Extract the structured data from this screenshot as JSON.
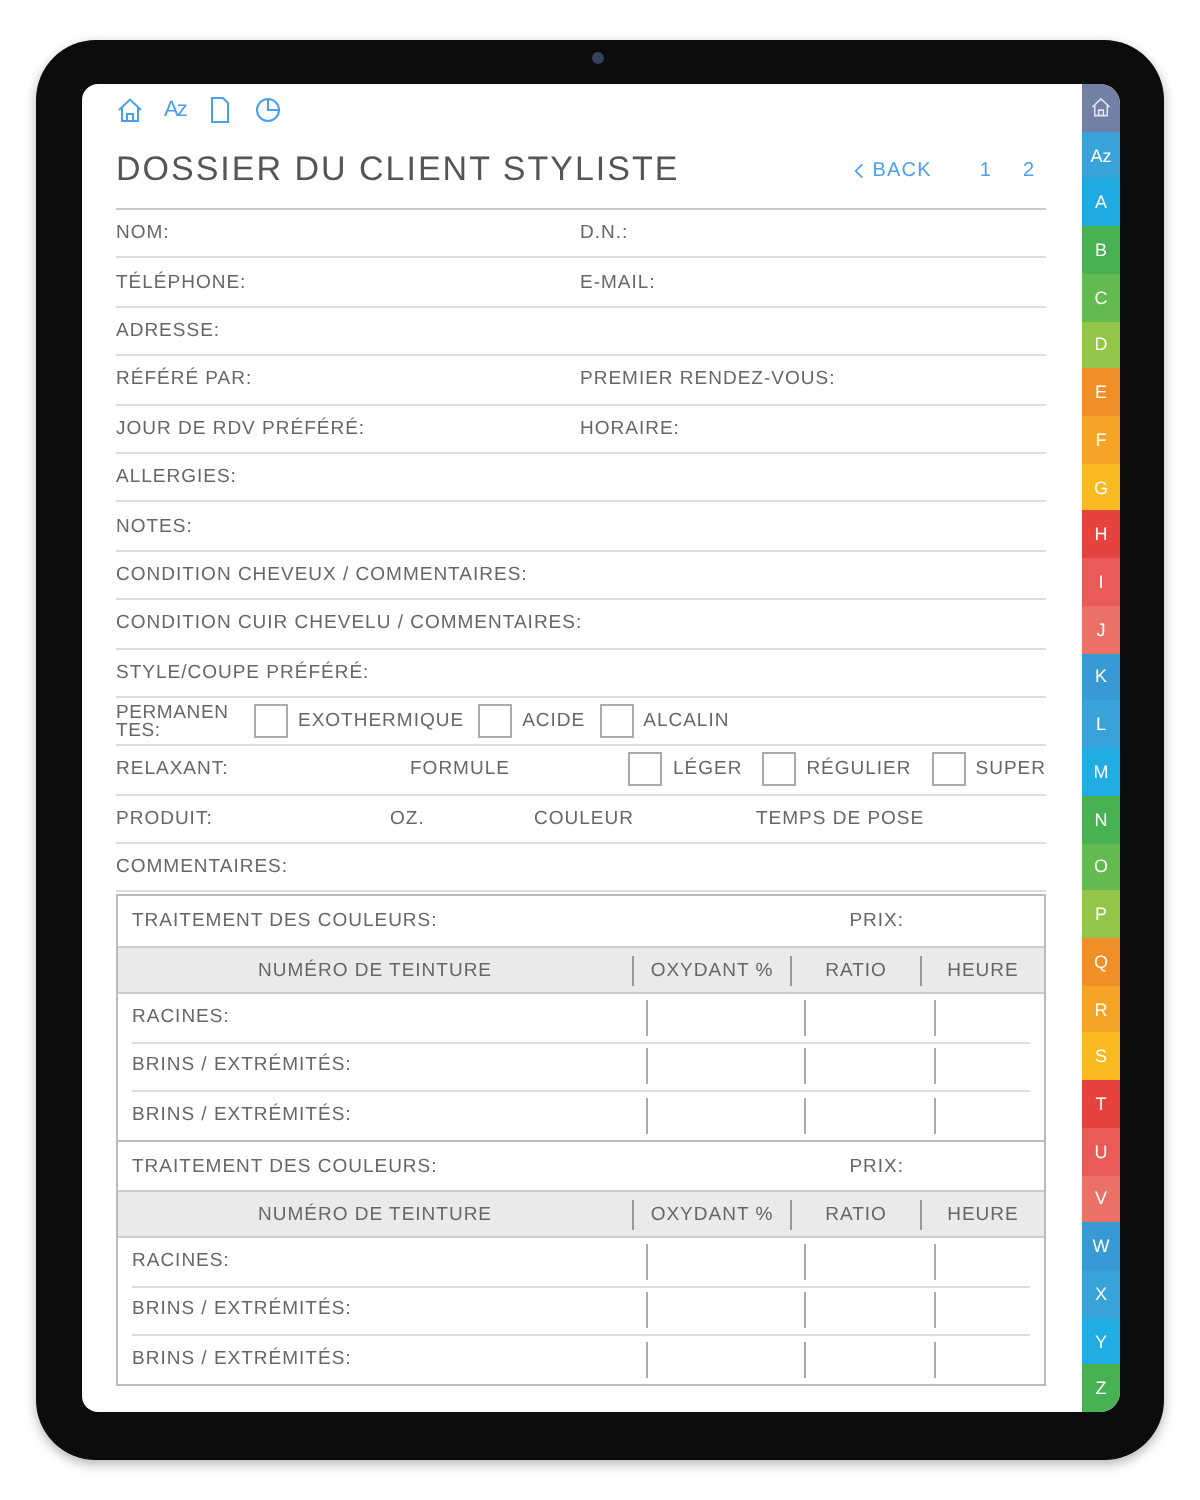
{
  "toolbar": [
    {
      "kind": "home"
    },
    {
      "kind": "text",
      "label": "Az"
    },
    {
      "kind": "page"
    },
    {
      "kind": "pie"
    }
  ],
  "title": "DOSSIER DU CLIENT STYLISTE",
  "back": "BACK",
  "pages": [
    "1",
    "2"
  ],
  "rows": [
    {
      "kind": "two",
      "cells": [
        {
          "kind": "text",
          "text": "NOM:"
        },
        {
          "kind": "text",
          "text": "D.N.:"
        }
      ]
    },
    {
      "kind": "two",
      "cells": [
        {
          "kind": "text",
          "text": "TÉLÉPHONE:"
        },
        {
          "kind": "text",
          "text": "E-MAIL:"
        }
      ]
    },
    {
      "kind": "one",
      "cells": [
        {
          "kind": "text",
          "text": "ADRESSE:"
        }
      ]
    },
    {
      "kind": "two",
      "cells": [
        {
          "kind": "text",
          "text": "RÉFÉRÉ PAR:"
        },
        {
          "kind": "text",
          "text": "PREMIER RENDEZ-VOUS:"
        }
      ]
    },
    {
      "kind": "two",
      "cells": [
        {
          "kind": "text",
          "text": "JOUR DE RDV PRÉFÉRÉ:"
        },
        {
          "kind": "text",
          "text": "HORAIRE:"
        }
      ]
    },
    {
      "kind": "one",
      "cells": [
        {
          "kind": "text",
          "text": "ALLERGIES:"
        }
      ]
    },
    {
      "kind": "one",
      "cells": [
        {
          "kind": "text",
          "text": "NOTES:"
        }
      ]
    },
    {
      "kind": "one",
      "cells": [
        {
          "kind": "text",
          "text": "CONDITION CHEVEUX / COMMENTAIRES:"
        }
      ]
    },
    {
      "kind": "one",
      "cells": [
        {
          "kind": "text",
          "text": "CONDITION CUIR CHEVELU / COMMENTAIRES:"
        }
      ]
    },
    {
      "kind": "one",
      "cells": [
        {
          "kind": "text",
          "text": "STYLE/COUPE PRÉFÉRÉ:"
        }
      ]
    },
    {
      "kind": "perm",
      "cells": [
        {
          "kind": "text",
          "text": "PERMANENTES:"
        },
        {
          "kind": "check",
          "text": "EXOTHERMIQUE",
          "checked": false
        },
        {
          "kind": "check",
          "text": "ACIDE",
          "checked": false
        },
        {
          "kind": "check",
          "text": "ALCALIN",
          "checked": false
        }
      ]
    },
    {
      "kind": "relax",
      "cells": [
        {
          "kind": "text",
          "text": "RELAXANT:"
        },
        {
          "kind": "text",
          "text": "FORMULE"
        },
        {
          "kind": "check",
          "text": "LÉGER",
          "checked": false
        },
        {
          "kind": "check",
          "text": "RÉGULIER",
          "checked": false
        },
        {
          "kind": "check",
          "text": "SUPER",
          "checked": false
        }
      ]
    },
    {
      "kind": "product",
      "cells": [
        {
          "kind": "text",
          "text": "PRODUIT:"
        },
        {
          "kind": "text",
          "text": "OZ."
        },
        {
          "kind": "text",
          "text": "COULEUR"
        },
        {
          "kind": "text",
          "text": "TEMPS DE POSE"
        }
      ]
    },
    {
      "kind": "one",
      "cells": [
        {
          "kind": "text",
          "text": "COMMENTAIRES:"
        }
      ]
    }
  ],
  "treatments": [
    {
      "title": "TRAITEMENT DES COULEURS:",
      "price": "PRIX:",
      "columns": [
        "NUMÉRO DE TEINTURE",
        "OXYDANT %",
        "RATIO",
        "HEURE"
      ],
      "rows": [
        "RACINES:",
        "BRINS / EXTRÉMITÉS:",
        "BRINS / EXTRÉMITÉS:"
      ]
    },
    {
      "title": "TRAITEMENT DES COULEURS:",
      "price": "PRIX:",
      "columns": [
        "NUMÉRO DE TEINTURE",
        "OXYDANT %",
        "RATIO",
        "HEURE"
      ],
      "rows": [
        "RACINES:",
        "BRINS / EXTRÉMITÉS:",
        "BRINS / EXTRÉMITÉS:"
      ]
    }
  ],
  "tabs": [
    {
      "kind": "home",
      "color": "#6b7aa1"
    },
    {
      "kind": "text",
      "label": "Az",
      "color": "#2e9fd8"
    },
    {
      "kind": "text",
      "label": "A",
      "color": "#12a7e0"
    },
    {
      "kind": "text",
      "label": "B",
      "color": "#3fae49"
    },
    {
      "kind": "text",
      "label": "C",
      "color": "#5bb846"
    },
    {
      "kind": "text",
      "label": "D",
      "color": "#8dc23f"
    },
    {
      "kind": "text",
      "label": "E",
      "color": "#f08a1c"
    },
    {
      "kind": "text",
      "label": "F",
      "color": "#f5a01a"
    },
    {
      "kind": "text",
      "label": "G",
      "color": "#f8b616"
    },
    {
      "kind": "text",
      "label": "H",
      "color": "#e53935"
    },
    {
      "kind": "text",
      "label": "I",
      "color": "#e9534f"
    },
    {
      "kind": "text",
      "label": "J",
      "color": "#ea6a5e"
    },
    {
      "kind": "text",
      "label": "K",
      "color": "#2e95d3"
    },
    {
      "kind": "text",
      "label": "L",
      "color": "#2e9fd8"
    },
    {
      "kind": "text",
      "label": "M",
      "color": "#14a9e2"
    },
    {
      "kind": "text",
      "label": "N",
      "color": "#3fae49"
    },
    {
      "kind": "text",
      "label": "O",
      "color": "#5bb846"
    },
    {
      "kind": "text",
      "label": "P",
      "color": "#8dc23f"
    },
    {
      "kind": "text",
      "label": "Q",
      "color": "#f08a1c"
    },
    {
      "kind": "text",
      "label": "R",
      "color": "#f5a01a"
    },
    {
      "kind": "text",
      "label": "S",
      "color": "#f8b616"
    },
    {
      "kind": "text",
      "label": "T",
      "color": "#e53935"
    },
    {
      "kind": "text",
      "label": "U",
      "color": "#e9534f"
    },
    {
      "kind": "text",
      "label": "V",
      "color": "#ea6a5e"
    },
    {
      "kind": "text",
      "label": "W",
      "color": "#2e95d3"
    },
    {
      "kind": "text",
      "label": "X",
      "color": "#2e9fd8"
    },
    {
      "kind": "text",
      "label": "Y",
      "color": "#14a9e2"
    },
    {
      "kind": "text",
      "label": "Z",
      "color": "#3fae49"
    }
  ]
}
